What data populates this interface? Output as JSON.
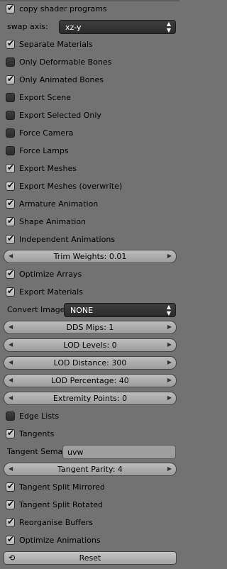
{
  "top_checkbox": {
    "label": "copy shader programs",
    "checked": true
  },
  "swap_axis": {
    "label": "swap axis:",
    "value": "xz-y"
  },
  "group1": [
    {
      "label": "Separate Materials",
      "checked": true
    },
    {
      "label": "Only Deformable Bones",
      "checked": false
    },
    {
      "label": "Only Animated Bones",
      "checked": true
    },
    {
      "label": "Export Scene",
      "checked": false
    },
    {
      "label": "Export Selected Only",
      "checked": false
    },
    {
      "label": "Force Camera",
      "checked": false
    },
    {
      "label": "Force Lamps",
      "checked": false
    },
    {
      "label": "Export Meshes",
      "checked": true
    },
    {
      "label": "Export Meshes (overwrite)",
      "checked": true
    },
    {
      "label": "Armature Animation",
      "checked": true
    },
    {
      "label": "Shape Animation",
      "checked": true
    },
    {
      "label": "Independent Animations",
      "checked": true
    }
  ],
  "trim_weights": "Trim Weights: 0.01",
  "group2": [
    {
      "label": "Optimize Arrays",
      "checked": true
    },
    {
      "label": "Export Materials",
      "checked": true
    }
  ],
  "convert_image": {
    "label": "Convert Image",
    "value": "NONE"
  },
  "sliders": [
    "DDS Mips: 1",
    "LOD Levels: 0",
    "LOD Distance: 300",
    "LOD Percentage: 40",
    "Extremity Points: 0"
  ],
  "group3": [
    {
      "label": "Edge Lists",
      "checked": false
    },
    {
      "label": "Tangents",
      "checked": true
    }
  ],
  "tangent_sema": {
    "label": "Tangent Sema",
    "value": "uvw"
  },
  "tangent_parity": "Tangent Parity: 4",
  "group4": [
    {
      "label": "Tangent Split Mirrored",
      "checked": true
    },
    {
      "label": "Tangent Split Rotated",
      "checked": true
    },
    {
      "label": "Reorganise Buffers",
      "checked": true
    },
    {
      "label": "Optimize Animations",
      "checked": true
    }
  ],
  "reset_label": "Reset"
}
